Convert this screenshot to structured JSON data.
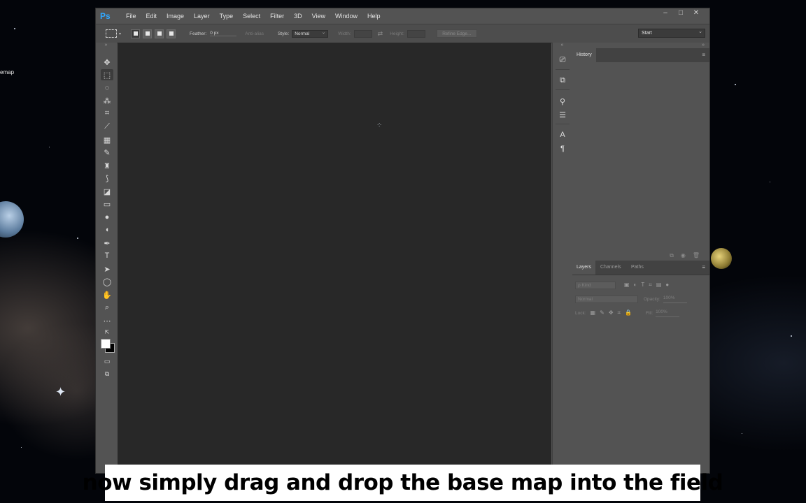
{
  "desktop": {
    "label_fragment": "emap"
  },
  "app": {
    "logo": "Ps"
  },
  "menu": [
    "File",
    "Edit",
    "Image",
    "Layer",
    "Type",
    "Select",
    "Filter",
    "3D",
    "View",
    "Window",
    "Help"
  ],
  "window_controls": {
    "minimize": "–",
    "maximize": "□",
    "close": "✕"
  },
  "options_bar": {
    "feather_label": "Feather:",
    "feather_value": "0 px",
    "antialias_label": "Anti-alias",
    "style_label": "Style:",
    "style_value": "Normal",
    "width_label": "Width:",
    "height_label": "Height:",
    "refine_edge": "Refine Edge...",
    "workspace": "Start"
  },
  "panels": {
    "history": {
      "tab": "History"
    },
    "layers": {
      "tabs": [
        "Layers",
        "Channels",
        "Paths"
      ],
      "kind_placeholder": "ρ Kind",
      "blend_mode": "Normal",
      "opacity_label": "Opacity:",
      "opacity_value": "100%",
      "lock_label": "Lock:",
      "fill_label": "Fill:",
      "fill_value": "100%"
    }
  },
  "caption": "now simply drag and drop the base map into the field"
}
